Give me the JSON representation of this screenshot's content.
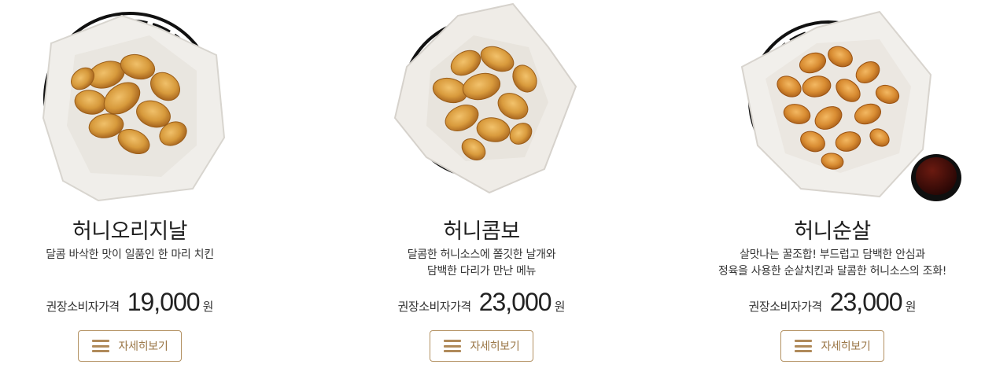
{
  "products": [
    {
      "name": "허니오리지날",
      "description": [
        "달콤 바삭한 맛이 일품인 한 마리 치킨"
      ],
      "price_label": "권장소비자가격",
      "price": "19,000",
      "unit": "원",
      "detail_label": "자세히보기"
    },
    {
      "name": "허니콤보",
      "description": [
        "달콤한 허니소스에 쫄깃한 날개와",
        "담백한 다리가 만난 메뉴"
      ],
      "price_label": "권장소비자가격",
      "price": "23,000",
      "unit": "원",
      "detail_label": "자세히보기"
    },
    {
      "name": "허니순살",
      "description": [
        "살맛나는 꿀조합! 부드럽고 담백한 안심과",
        "정육을 사용한 순살치킨과 달콤한 허니소스의 조화!"
      ],
      "price_label": "권장소비자가격",
      "price": "23,000",
      "unit": "원",
      "detail_label": "자세히보기"
    }
  ],
  "colors": {
    "accent": "#b39162",
    "button_text": "#9a7646",
    "chicken": "#d69a3a",
    "basket": "#1a1a1a"
  },
  "icons": [
    "menu-icon"
  ]
}
